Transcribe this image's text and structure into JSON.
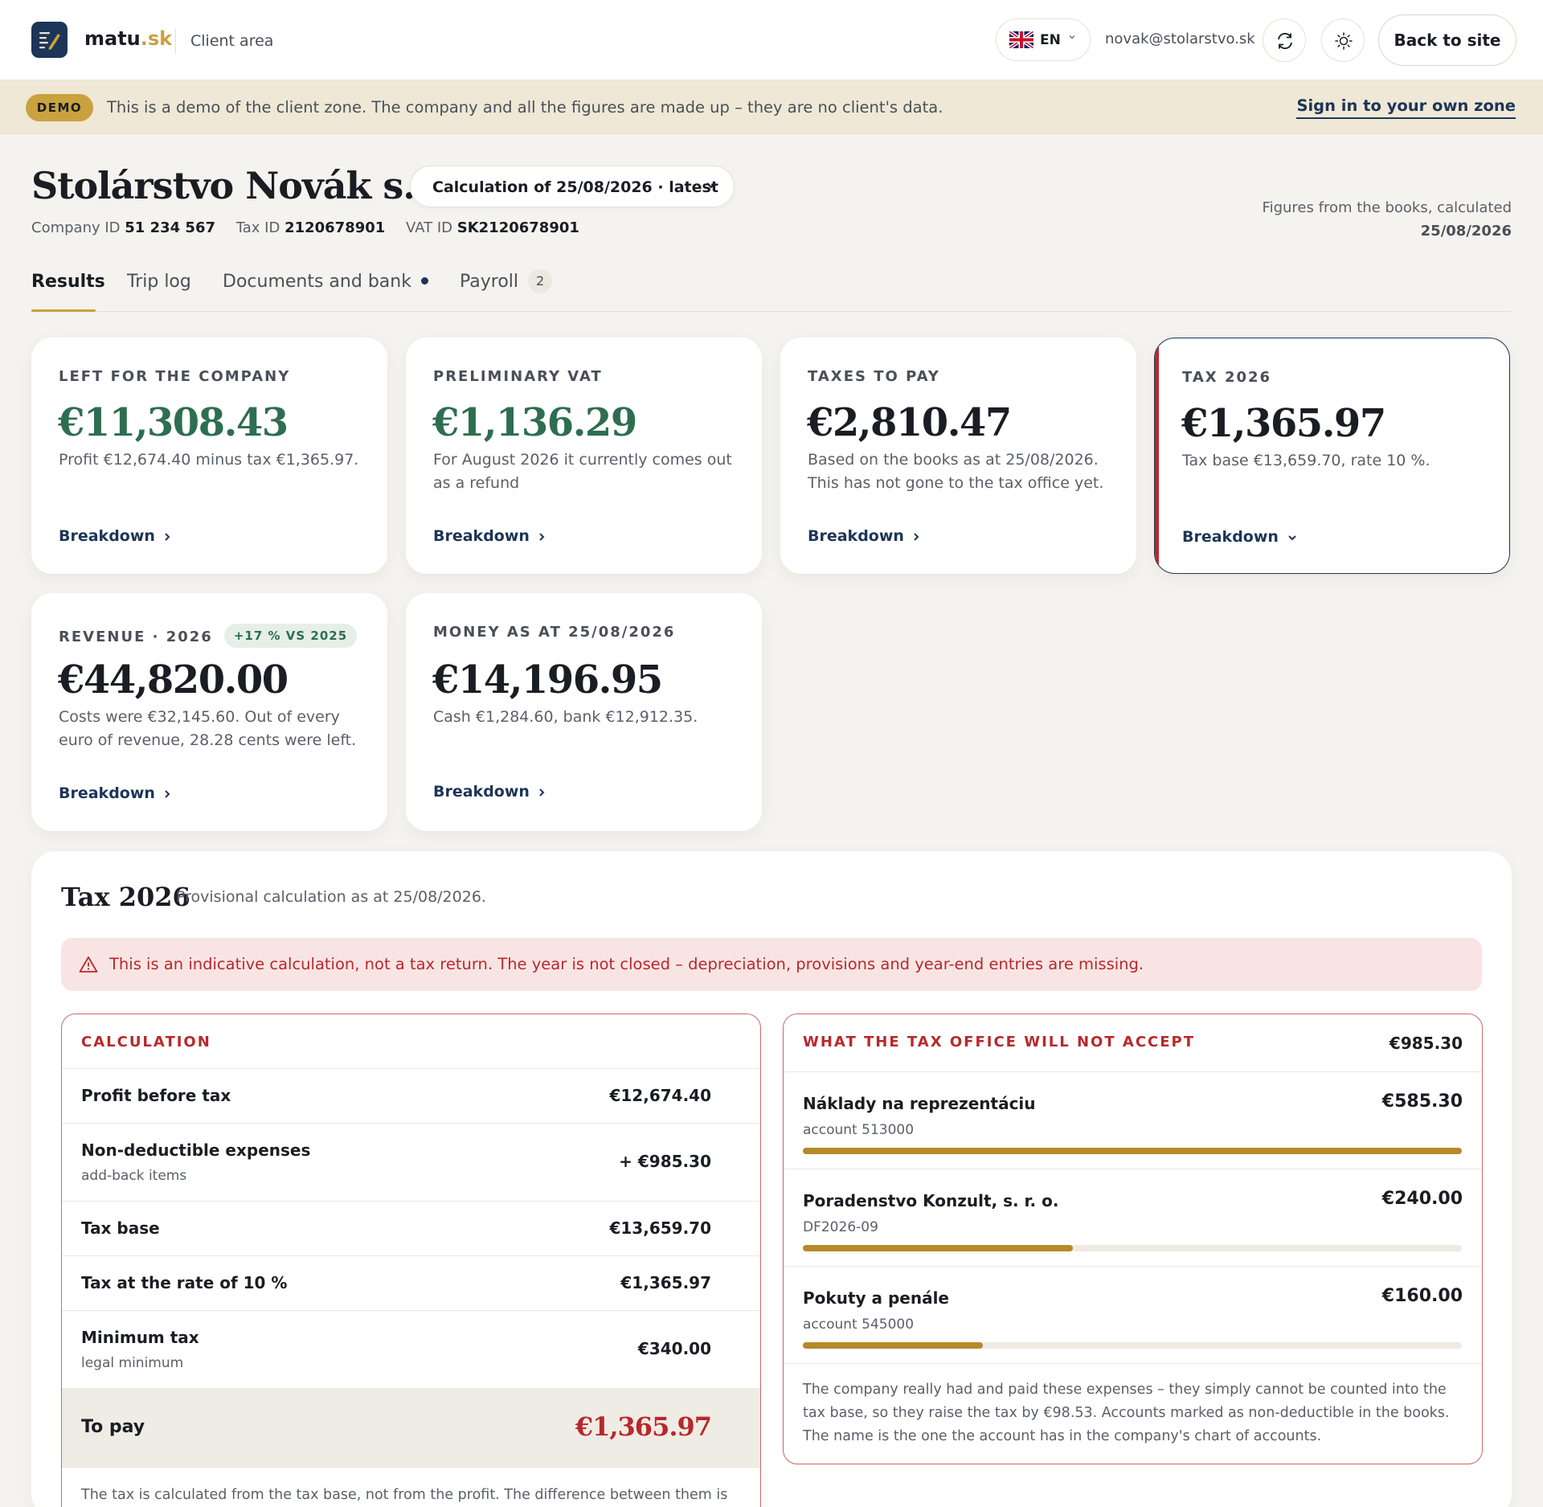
{
  "header": {
    "brand_main": "matu",
    "brand_tld": ".sk",
    "client_area": "Client area",
    "language": "EN",
    "user_email": "novak@stolarstvo.sk",
    "back_label": "Back to site"
  },
  "demo": {
    "badge": "DEMO",
    "text": "This is a demo of the client zone. The company and all the figures are made up – they are no client's data.",
    "link": "Sign in to your own zone"
  },
  "company": {
    "name": "Stolárstvo Novák s. r. o.",
    "calculation_select": "Calculation of 25/08/2026 · latest",
    "company_id_label": "Company ID",
    "company_id": "51 234 567",
    "tax_id_label": "Tax ID",
    "tax_id": "2120678901",
    "vat_id_label": "VAT ID",
    "vat_id": "SK2120678901",
    "figures_note": "Figures from the books, calculated",
    "figures_date": "25/08/2026"
  },
  "tabs": [
    {
      "label": "Results"
    },
    {
      "label": "Trip log"
    },
    {
      "label": "Documents and bank"
    },
    {
      "label": "Payroll",
      "count": "2"
    }
  ],
  "cards": [
    {
      "label": "Left for the company",
      "value": "€11,308.43",
      "desc": "Profit €12,674.40 minus tax €1,365.97.",
      "link": "Breakdown"
    },
    {
      "label": "Preliminary VAT",
      "value": "€1,136.29",
      "desc": "For August 2026 it currently comes out as a refund",
      "link": "Breakdown"
    },
    {
      "label": "Taxes to pay",
      "value": "€2,810.47",
      "desc": "Based on the books as at 25/08/2026. This has not gone to the tax office yet.",
      "link": "Breakdown"
    },
    {
      "label": "Tax 2026",
      "value": "€1,365.97",
      "desc": "Tax base €13,659.70, rate 10 %.",
      "link": "Breakdown"
    },
    {
      "label": "Revenue · 2026",
      "badge": "+17 % vs 2025",
      "value": "€44,820.00",
      "desc": "Costs were €32,145.60. Out of every euro of revenue, 28.28 cents were left.",
      "link": "Breakdown"
    },
    {
      "label": "Money as at 25/08/2026",
      "value": "€14,196.95",
      "desc": "Cash €1,284.60, bank €12,912.35.",
      "link": "Breakdown"
    }
  ],
  "tax_panel": {
    "title": "Tax 2026",
    "subtitle": "Provisional calculation as at 25/08/2026.",
    "warning": "This is an indicative calculation, not a tax return. The year is not closed – depreciation, provisions and year-end entries are missing.",
    "calculation": {
      "label": "Calculation",
      "rows": [
        {
          "name": "Profit before tax",
          "value": "€12,674.40"
        },
        {
          "name": "Non-deductible expenses",
          "sub": "add-back items",
          "value": "+ €985.30"
        },
        {
          "name": "Tax base",
          "value": "€13,659.70"
        },
        {
          "name": "Tax at the rate of 10 %",
          "value": "€1,365.97"
        },
        {
          "name": "Minimum tax",
          "sub": "legal minimum",
          "value": "€340.00"
        }
      ],
      "total_name": "To pay",
      "total_value": "€1,365.97",
      "footnote": "The tax is calculated from the tax base, not from the profit. The difference between them is"
    },
    "non_deductible": {
      "label": "What the tax office will not accept",
      "total": "€985.30",
      "items": [
        {
          "name": "Náklady na reprezentáciu",
          "sub": "account 513000",
          "value": "€585.30",
          "share": 1.0
        },
        {
          "name": "Poradenstvo Konzult, s. r. o.",
          "sub": "DF2026-09",
          "value": "€240.00",
          "share": 0.41
        },
        {
          "name": "Pokuty a penále",
          "sub": "account 545000",
          "value": "€160.00",
          "share": 0.273
        }
      ],
      "note": "The company really had and paid these expenses – they simply cannot be counted into the tax base, so they raise the tax by €98.53. Accounts marked as non-deductible in the books. The name is the one the account has in the company's chart of accounts."
    }
  }
}
